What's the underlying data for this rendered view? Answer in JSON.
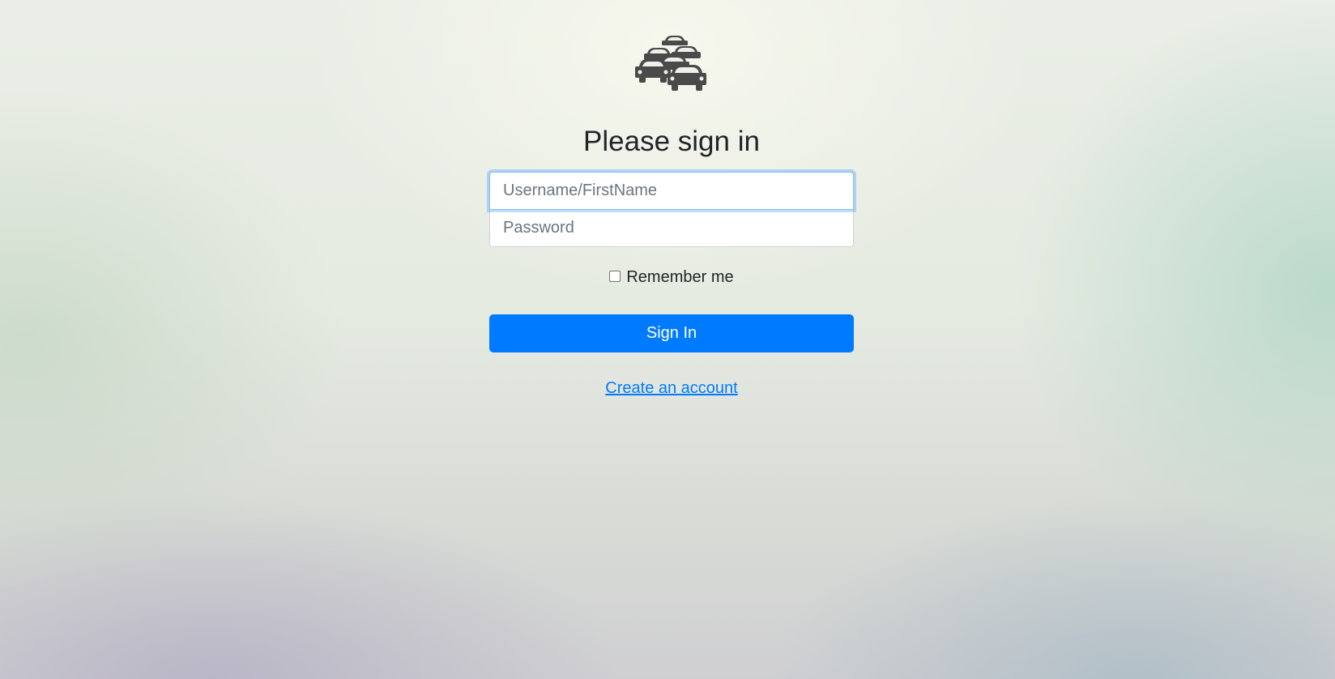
{
  "logo": {
    "icon": "cars-traffic-icon",
    "color": "#4a4a4a"
  },
  "heading": "Please sign in",
  "username": {
    "placeholder": "Username/FirstName",
    "value": ""
  },
  "password": {
    "placeholder": "Password",
    "value": ""
  },
  "remember": {
    "label": "Remember me",
    "checked": false
  },
  "signin_button": {
    "label": "Sign In",
    "color": "#007bff"
  },
  "create_account_link": "Create an account"
}
